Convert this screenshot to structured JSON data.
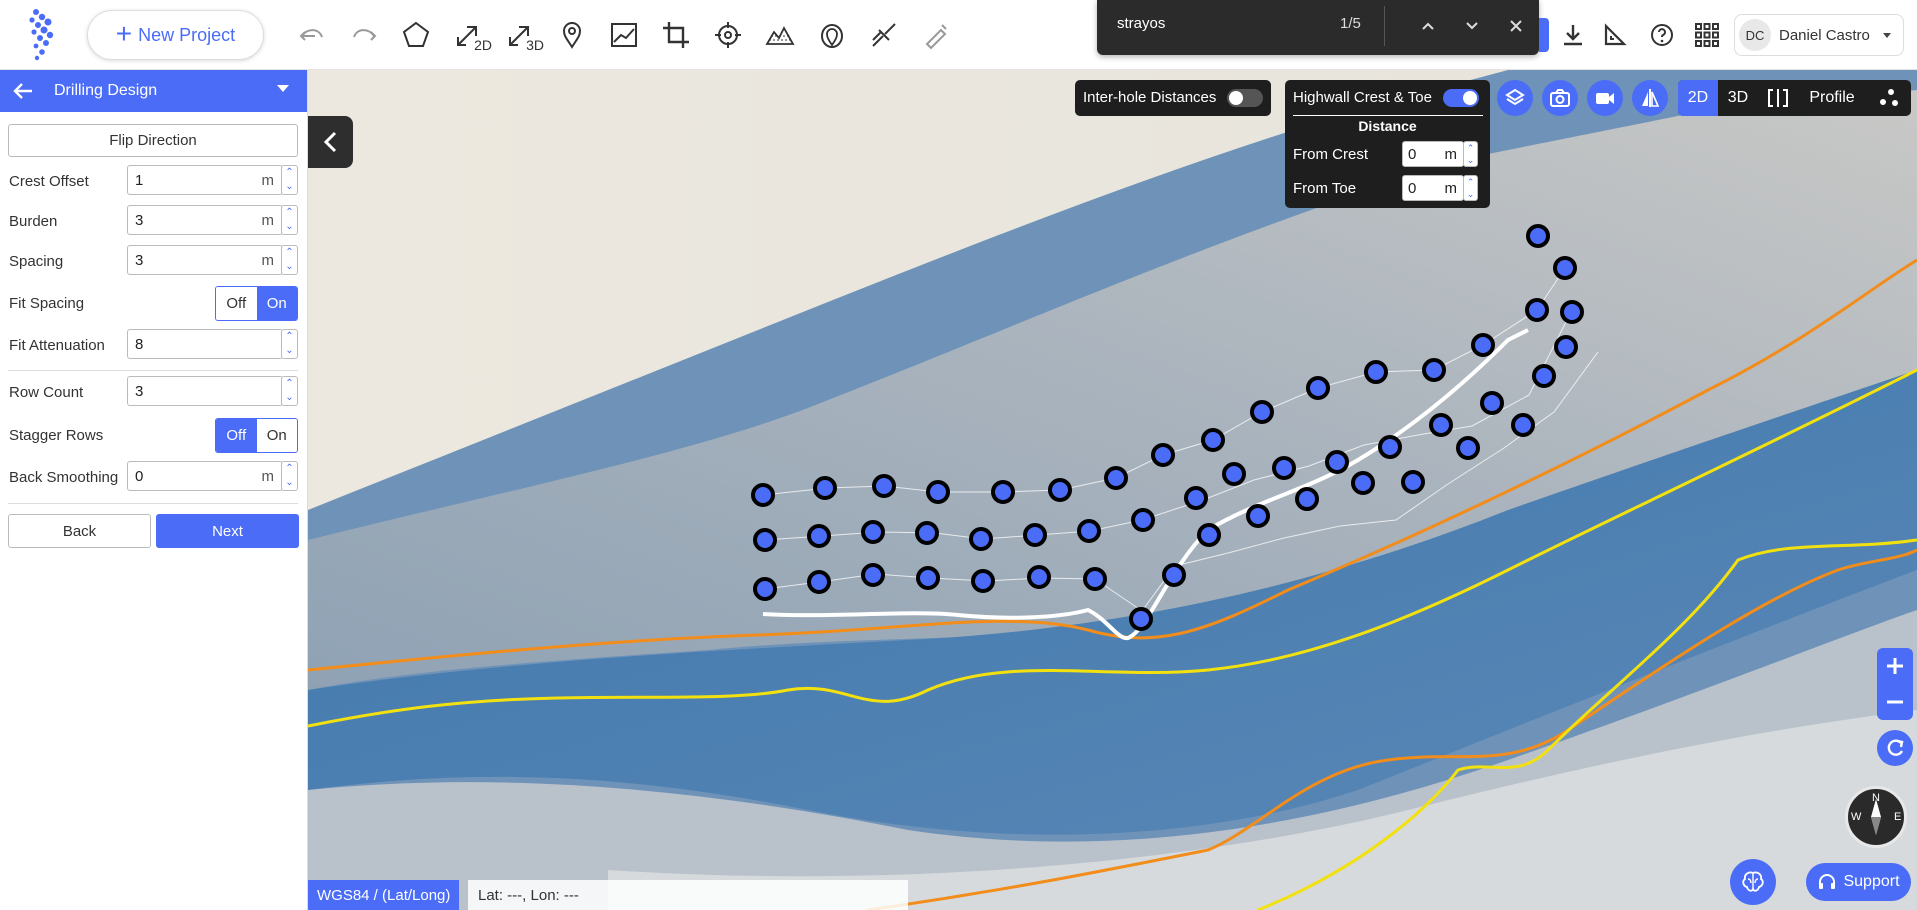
{
  "topbar": {
    "new_project_label": "New Project",
    "tools": [
      "undo-icon",
      "redo-icon",
      "polygon-icon",
      "measure-2d-icon",
      "measure-3d-icon",
      "marker-icon",
      "profile-chart-icon",
      "crop-icon",
      "target-icon",
      "volume-icon",
      "location-pin-icon",
      "drill-icon",
      "pen-icon"
    ],
    "tool_2d_label": "2D",
    "tool_3d_label": "3D",
    "find": {
      "query": "strayos",
      "count": "1/5"
    },
    "user": {
      "initials": "DC",
      "name": "Daniel Castro"
    }
  },
  "sidebar": {
    "title": "Drilling Design",
    "flip_label": "Flip Direction",
    "fields": {
      "crest_offset": {
        "label": "Crest Offset",
        "value": "1",
        "unit": "m"
      },
      "burden": {
        "label": "Burden",
        "value": "3",
        "unit": "m"
      },
      "spacing": {
        "label": "Spacing",
        "value": "3",
        "unit": "m"
      },
      "fit_spacing": {
        "label": "Fit Spacing",
        "off": "Off",
        "on": "On",
        "selected": "On"
      },
      "fit_attenuation": {
        "label": "Fit Attenuation",
        "value": "8"
      },
      "row_count": {
        "label": "Row Count",
        "value": "3"
      },
      "stagger_rows": {
        "label": "Stagger Rows",
        "off": "Off",
        "on": "On",
        "selected": "Off"
      },
      "back_smoothing": {
        "label": "Back Smoothing",
        "value": "0",
        "unit": "m"
      }
    },
    "back_label": "Back",
    "next_label": "Next"
  },
  "map": {
    "inter_hole_label": "Inter-hole Distances",
    "inter_hole_enabled": false,
    "highwall_label": "Highwall Crest & Toe",
    "highwall_enabled": true,
    "distance_heading": "Distance",
    "from_crest": {
      "label": "From Crest",
      "value": "0",
      "unit": "m"
    },
    "from_toe": {
      "label": "From Toe",
      "value": "0",
      "unit": "m"
    },
    "view_modes": [
      "2D",
      "3D",
      "Profile"
    ],
    "active_view": "2D",
    "coord_system": "WGS84 / (Lat/Long)",
    "coord_readout": "Lat: ---, Lon: ---",
    "support_label": "Support",
    "compass": {
      "n": "N",
      "e": "E",
      "w": "W"
    }
  },
  "colors": {
    "accent": "#4a6cf7",
    "dark_panel": "#1e1e1e",
    "highwall_line": "#ffffff",
    "orange_line": "#f28c1a",
    "yellow_line": "#f2e10f"
  }
}
